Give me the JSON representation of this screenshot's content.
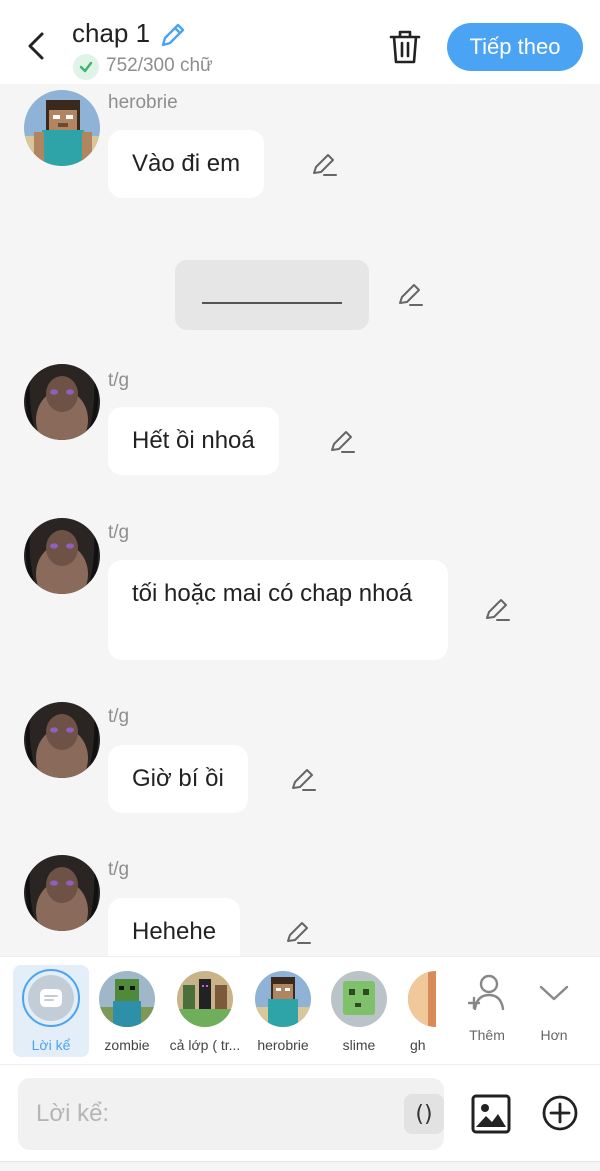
{
  "header": {
    "title": "chap 1",
    "word_count": "752/300 chữ",
    "next_label": "Tiếp theo"
  },
  "messages": [
    {
      "author": "herobrie",
      "text": "Vào đi em"
    },
    {
      "author": "t/g",
      "text": "Hết ồi nhoá"
    },
    {
      "author": "t/g",
      "text": "tối hoặc mai có chap nhoá"
    },
    {
      "author": "t/g",
      "text": "Giờ bí ồi"
    },
    {
      "author": "t/g",
      "text": "Hehehe"
    }
  ],
  "characters": [
    {
      "label": "Lời kể"
    },
    {
      "label": "zombie"
    },
    {
      "label": "cả lớp ( tr..."
    },
    {
      "label": "herobrie"
    },
    {
      "label": "slime"
    },
    {
      "label": "gh"
    }
  ],
  "actions": {
    "add_label": "Thêm",
    "more_label": "Hơn"
  },
  "composer": {
    "placeholder": "Lời kể:",
    "paren": "()"
  },
  "colors": {
    "accent": "#4aa3f3",
    "bubble": "#ffffff",
    "background": "#f5f5f5"
  }
}
